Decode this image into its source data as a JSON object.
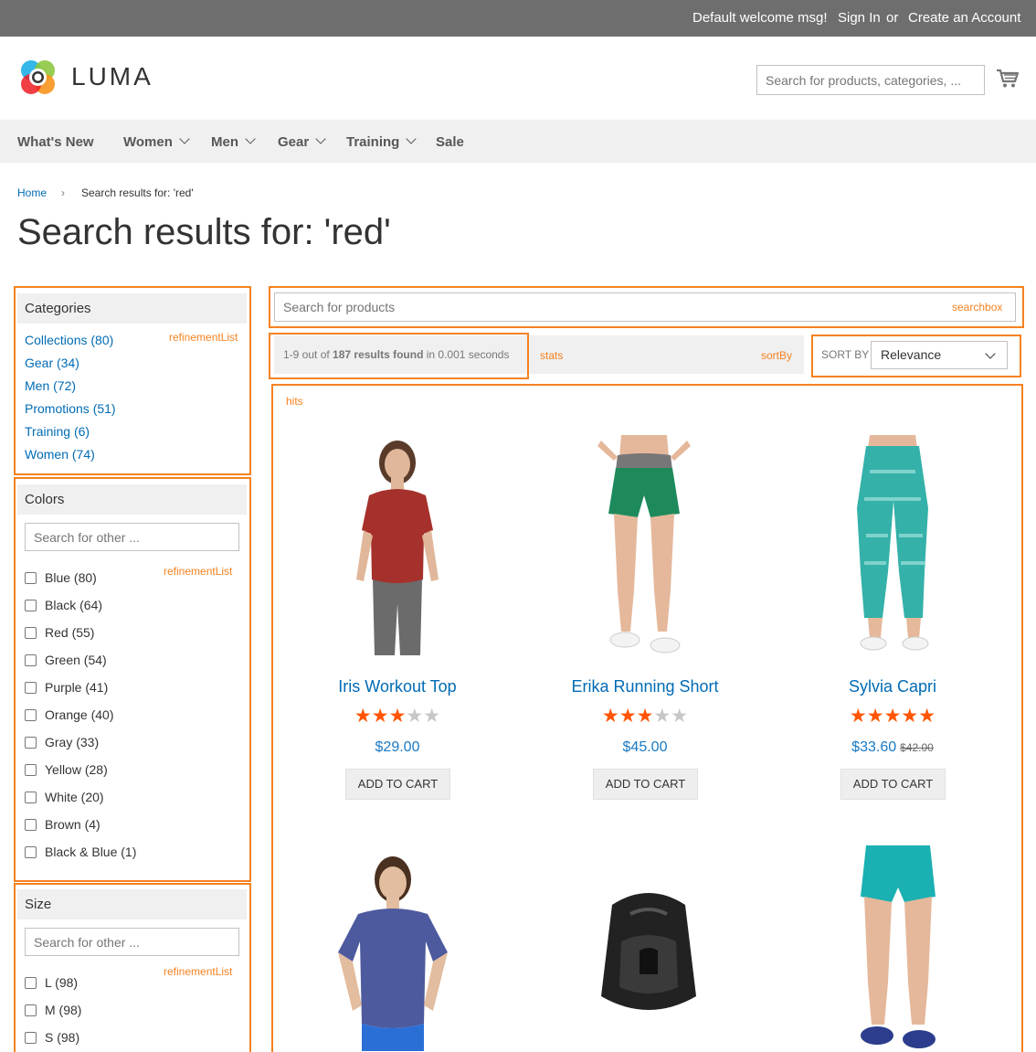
{
  "topbar": {
    "welcome": "Default welcome msg!",
    "signin": "Sign In",
    "or": "or",
    "create_account": "Create an Account"
  },
  "header": {
    "logo_text": "LUMA",
    "search_placeholder": "Search for products, categories, ..."
  },
  "nav": {
    "items": [
      {
        "label": "What's New",
        "dropdown": false
      },
      {
        "label": "Women",
        "dropdown": true
      },
      {
        "label": "Men",
        "dropdown": true
      },
      {
        "label": "Gear",
        "dropdown": true
      },
      {
        "label": "Training",
        "dropdown": true
      },
      {
        "label": "Sale",
        "dropdown": false
      }
    ]
  },
  "breadcrumb": {
    "home": "Home",
    "separator": "›",
    "current": "Search results for: 'red'"
  },
  "page_title": "Search results for: 'red'",
  "widget_labels": {
    "searchbox": "searchbox",
    "stats": "stats",
    "sortby": "sortBy",
    "hits": "hits",
    "refinement": "refinementList"
  },
  "facets": {
    "categories": {
      "title": "Categories",
      "items": [
        "Collections (80)",
        "Gear (34)",
        "Men (72)",
        "Promotions (51)",
        "Training (6)",
        "Women (74)"
      ]
    },
    "colors": {
      "title": "Colors",
      "search_placeholder": "Search for other ...",
      "items": [
        "Blue (80)",
        "Black (64)",
        "Red (55)",
        "Green (54)",
        "Purple (41)",
        "Orange (40)",
        "Gray (33)",
        "Yellow (28)",
        "White (20)",
        "Brown (4)",
        "Black & Blue (1)"
      ]
    },
    "size": {
      "title": "Size",
      "search_placeholder": "Search for other ...",
      "items": [
        "L (98)",
        "M (98)",
        "S (98)"
      ]
    }
  },
  "search": {
    "placeholder": "Search for products"
  },
  "stats": {
    "prefix": "1-9 out of ",
    "count": "187 results found",
    "suffix": " in 0.001 seconds"
  },
  "sort": {
    "label": "SORT BY",
    "selected": "Relevance"
  },
  "products": [
    {
      "name": "Iris Workout Top",
      "rating": 3,
      "price": "$29.00",
      "old_price": "",
      "button": "ADD TO CART"
    },
    {
      "name": "Erika Running Short",
      "rating": 3,
      "price": "$45.00",
      "old_price": "",
      "button": "ADD TO CART"
    },
    {
      "name": "Sylvia Capri",
      "rating": 5,
      "price": "$33.60",
      "old_price": "$42.00",
      "button": "ADD TO CART"
    }
  ],
  "colors": {
    "accent": "#f58220",
    "link": "#006bb4",
    "price": "#1979c3",
    "star": "#ff5501",
    "topbar": "#6e6e6e"
  }
}
